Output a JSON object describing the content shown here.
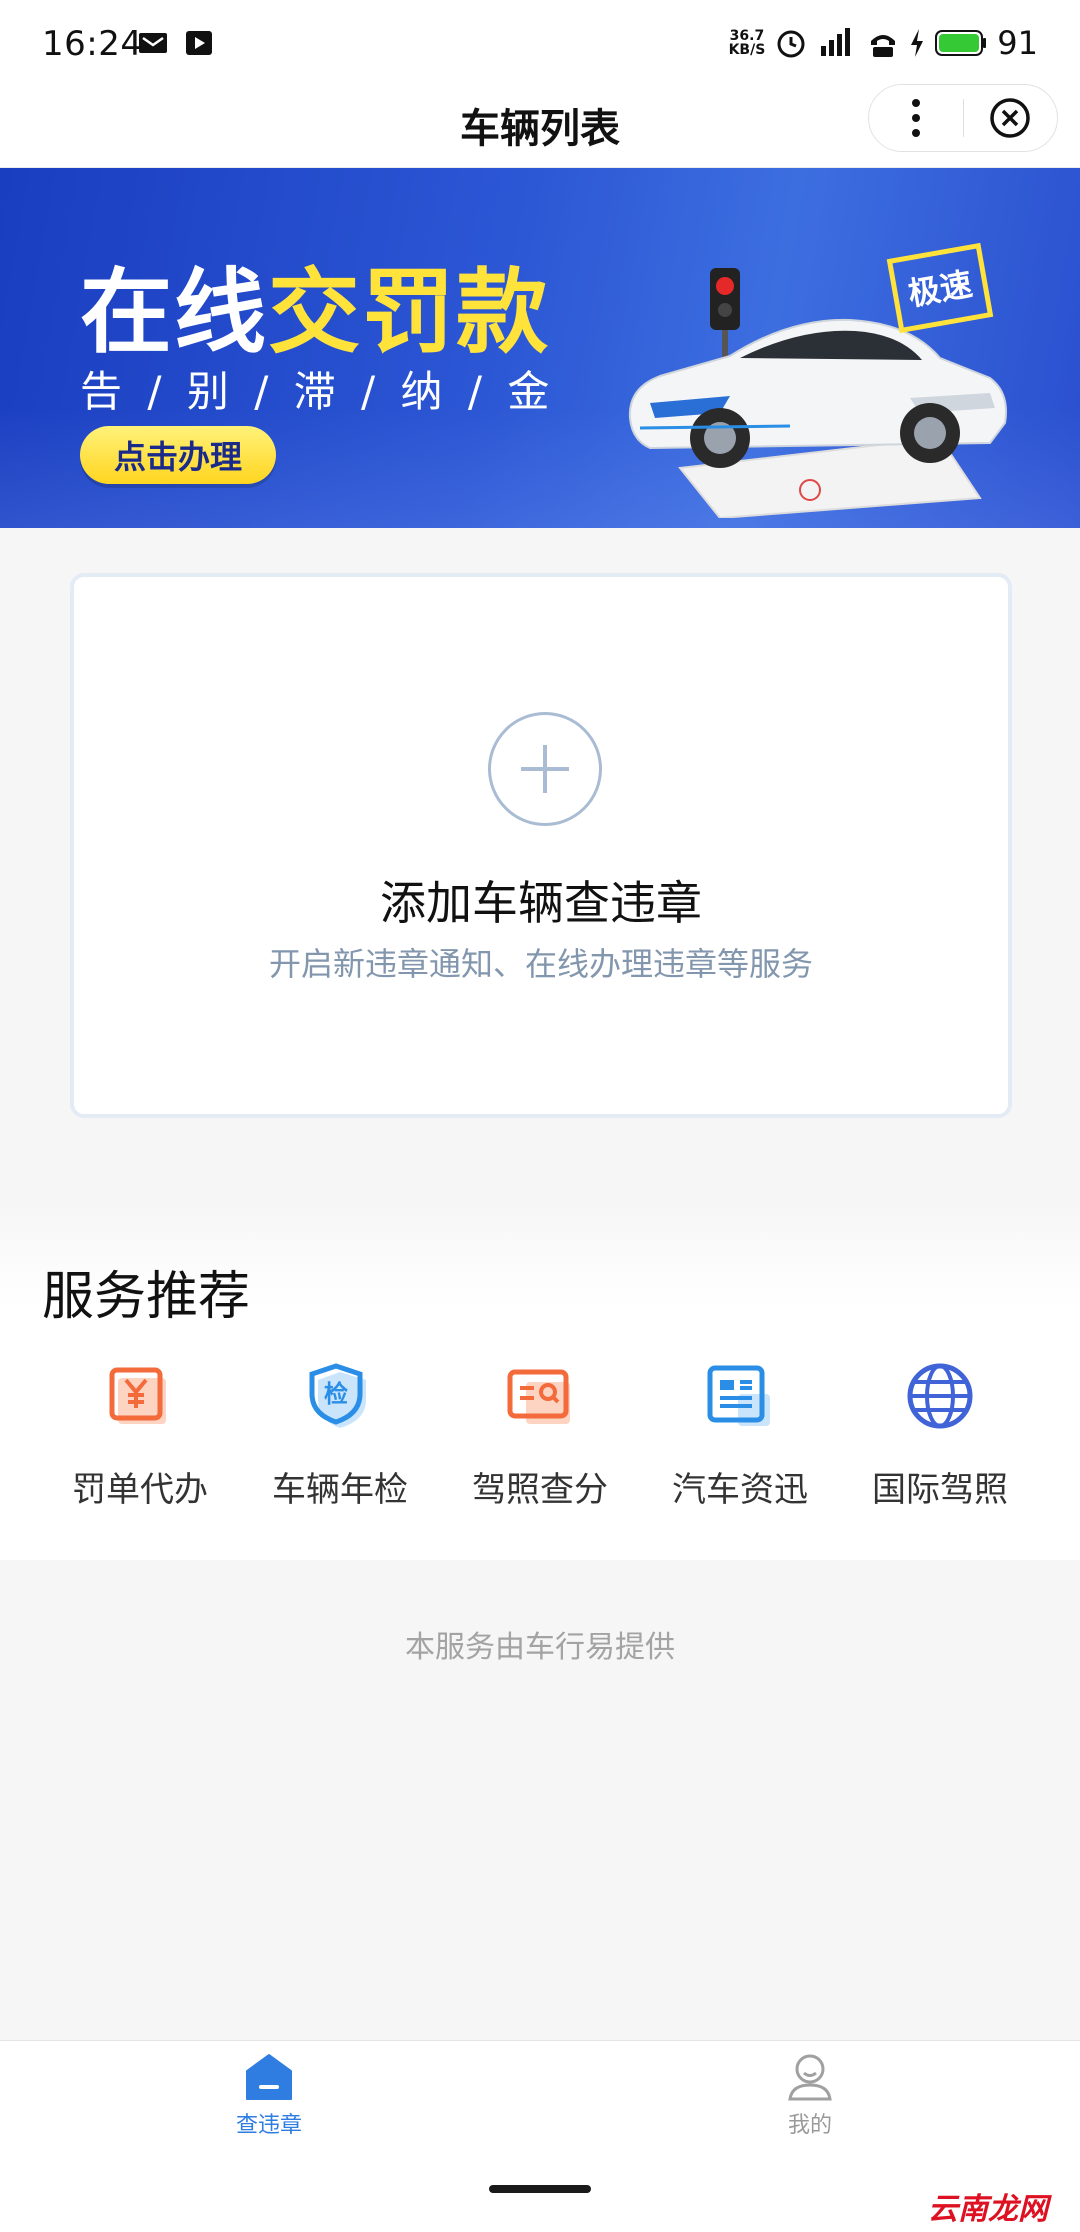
{
  "status_bar": {
    "time": "16:24",
    "net_speed_value": "36.7",
    "net_speed_unit": "KB/S",
    "battery": "91"
  },
  "header": {
    "title": "车辆列表"
  },
  "banner": {
    "title_white": "在线",
    "title_yellow": "交罚款",
    "subtitle": "告 / 别 / 滞 / 纳 / 金",
    "cta": "点击办理",
    "badge": "极速"
  },
  "add_vehicle": {
    "title": "添加车辆查违章",
    "description": "开启新违章通知、在线办理违章等服务"
  },
  "services": {
    "title": "服务推荐",
    "items": [
      {
        "label": "罚单代办",
        "icon": "fine-ticket-icon",
        "color": "#f36a3b"
      },
      {
        "label": "车辆年检",
        "icon": "inspection-shield-icon",
        "color": "#2a8ee6"
      },
      {
        "label": "驾照查分",
        "icon": "license-search-icon",
        "color": "#f36a3b"
      },
      {
        "label": "汽车资迅",
        "icon": "news-icon",
        "color": "#2a8ee6"
      },
      {
        "label": "国际驾照",
        "icon": "globe-icon",
        "color": "#4063d8"
      }
    ]
  },
  "footer": {
    "note": "本服务由车行易提供"
  },
  "tabbar": {
    "tabs": [
      {
        "label": "查违章",
        "active": true
      },
      {
        "label": "我的",
        "active": false
      }
    ]
  },
  "watermark": "云南龙网",
  "colors": {
    "accent": "#2f7de1",
    "banner_blue": "#2b56d4",
    "highlight_yellow": "#ffe23a"
  }
}
